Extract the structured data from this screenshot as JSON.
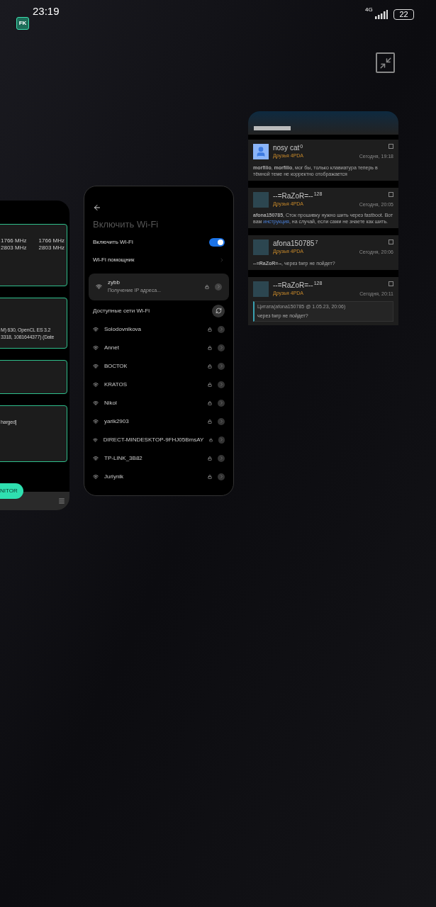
{
  "status_bar": {
    "time": "23:19",
    "app_badge": "FK",
    "network": "4G",
    "battery": "22"
  },
  "left_card": {
    "panels": [
      {
        "lines": [
          [
            "1766 MHz",
            "1766 MHz"
          ],
          [
            "2803 MHz",
            "2803 MHz"
          ]
        ]
      },
      {
        "lines": [
          [
            "M) 630, OpenCL ES 3.2"
          ],
          [
            "3318, 1081644377) (Date"
          ]
        ]
      },
      {
        "lines": [
          [
            "harged]"
          ]
        ]
      }
    ],
    "button": "NITOR"
  },
  "wifi_card": {
    "title": "Включить Wi-Fi",
    "toggle": {
      "label": "Включить Wi-Fi",
      "on": true
    },
    "assistant": "Wi-Fi помощник",
    "connected": {
      "name": "zybb",
      "status": "Получение IP адреса..."
    },
    "available_header": "Доступные сети Wi-Fi",
    "networks": [
      "Solodovnikova",
      "Annet",
      "ВОСТОК",
      "KRATOS",
      "Nikol",
      "yarik2903",
      "DIRECT-MINDESKTOP-9FHJ05BmsAY",
      "TP-LINK_3B82",
      "Juriynik"
    ]
  },
  "forum_card": {
    "posts": [
      {
        "author": "nosy cat",
        "count": "0",
        "group": "Друзья 4PDA",
        "time": "Сегодня, 19:18",
        "kind": "silhouette",
        "checked": false,
        "body": "**morfilio**, **morfilio**, мог бы, только клавиатура теперь в тёмной теме не корректно отображается"
      },
      {
        "author": "--=RaZoR=--",
        "count": "128",
        "group": "Друзья 4PDA",
        "time": "Сегодня, 20:05",
        "kind": "photo",
        "checked": false,
        "body": "**afona150785**, Сток прошивку нужно шить через fastboot. Вот вам",
        "link": "инструкция",
        "body_after": ", на случай, если сами не знаете как шить."
      },
      {
        "author": "afona150785",
        "count": "7",
        "group": "Друзья 4PDA",
        "time": "Сегодня, 20:06",
        "kind": "photo",
        "checked": false,
        "body": "**--=RaZoR=--**, через twrp не пойдет?"
      },
      {
        "author": "--=RaZoR=--",
        "count": "128",
        "group": "Друзья 4PDA",
        "time": "Сегодня, 20:11",
        "kind": "photo",
        "checked": false,
        "quote_head": "Цитата(afona150785 @ 1.05.23, 20:06)",
        "quote": "через twrp не пойдет?"
      }
    ]
  }
}
